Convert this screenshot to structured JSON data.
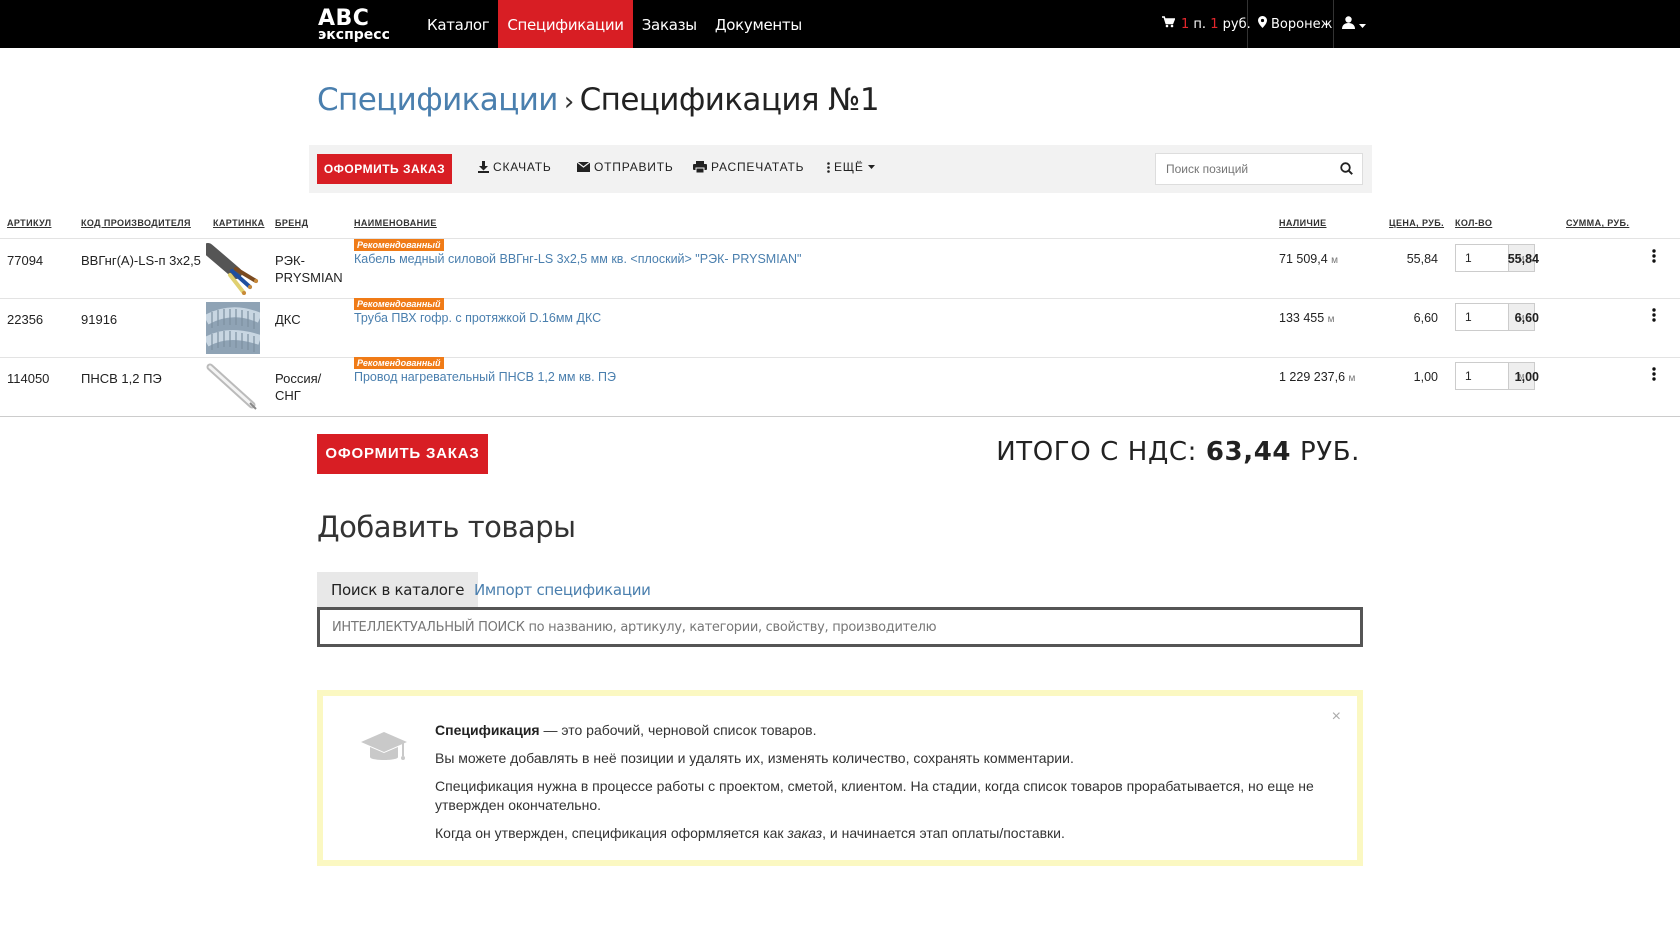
{
  "header": {
    "logo_line1": "ABC",
    "logo_line2": "экспресс",
    "nav": [
      "Каталог",
      "Спецификации",
      "Заказы",
      "Документы"
    ],
    "cart_count": "1",
    "cart_count_unit": "п.",
    "cart_sum": "1",
    "cart_sum_unit": "руб.",
    "city": "Воронеж"
  },
  "breadcrumb": {
    "parent": "Спецификации",
    "separator": "›",
    "current": "Спецификация №1"
  },
  "toolbar": {
    "order_button": "ОФОРМИТЬ ЗАКАЗ",
    "download": "СКАЧАТЬ",
    "send": "ОТПРАВИТЬ",
    "print": "РАСПЕЧАТАТЬ",
    "more": "ЕЩЁ",
    "search_placeholder": "Поиск позиций"
  },
  "table": {
    "headers": {
      "article": "АРТИКУЛ",
      "mfr_code": "КОД ПРОИЗВОДИТЕЛЯ",
      "image": "КАРТИНКА",
      "brand": "БРЕНД",
      "name": "НАИМЕНОВАНИЕ",
      "stock": "НАЛИЧИЕ",
      "price": "ЦЕНА, РУБ.",
      "qty": "КОЛ-ВО",
      "sum": "СУММА, РУБ."
    },
    "badge": "Рекомендованный",
    "rows": [
      {
        "article": "77094",
        "mfr_code": "ВВГнг(А)-LS-п 3х2,5",
        "brand": "РЭК-PRYSMIAN",
        "name": "Кабель медный силовой ВВГнг-LS 3х2,5 мм кв. <плоский> \"РЭК- PRYSMIAN\"",
        "stock": "71 509,4",
        "stock_unit": "м",
        "price": "55,84",
        "qty": "1",
        "qty_unit": "м",
        "sum": "55,84"
      },
      {
        "article": "22356",
        "mfr_code": "91916",
        "brand": "ДКС",
        "name": "Труба ПВХ гофр. с протяжкой D.16мм ДКС",
        "stock": "133 455",
        "stock_unit": "м",
        "price": "6,60",
        "qty": "1",
        "qty_unit": "м",
        "sum": "6,60"
      },
      {
        "article": "114050",
        "mfr_code": "ПНСВ 1,2 ПЭ",
        "brand": "Россия/СНГ",
        "name": "Провод нагревательный ПНСВ 1,2 мм кв. ПЭ",
        "stock": "1 229 237,6",
        "stock_unit": "м",
        "price": "1,00",
        "qty": "1",
        "qty_unit": "м",
        "sum": "1,00"
      }
    ]
  },
  "totals": {
    "order_button": "ОФОРМИТЬ ЗАКАЗ",
    "label": "ИТОГО С НДС:",
    "value": "63,44",
    "currency": "РУБ."
  },
  "add_goods": {
    "title": "Добавить товары",
    "tab_search": "Поиск в каталоге",
    "tab_import": "Импорт спецификации",
    "smart_search_bold": "ИНТЕЛЛЕКТУАЛЬНЫЙ ПОИСК",
    "smart_search_rest": " по названию, артикулу, категории, свойству, производителю"
  },
  "info": {
    "term": "Спецификация",
    "line1_rest": " — это рабочий, черновой список товаров.",
    "line2": "Вы можете добавлять в неё позиции и удалять их, изменять количество, сохранять комментарии.",
    "line3": "Спецификация нужна в процессе работы с проектом, сметой, клиентом. На стадии, когда список товаров прорабатывается, но еще не утвержден окончательно.",
    "line4_a": "Когда он утвержден, спецификация оформляется как ",
    "line4_em": "заказ",
    "line4_b": ", и начинается этап оплаты/поставки.",
    "close": "×"
  },
  "colors": {
    "brand_red": "#d81e24",
    "link_blue": "#4a7fae",
    "badge_orange": "#f07b17",
    "info_border": "#fbf8c2"
  }
}
